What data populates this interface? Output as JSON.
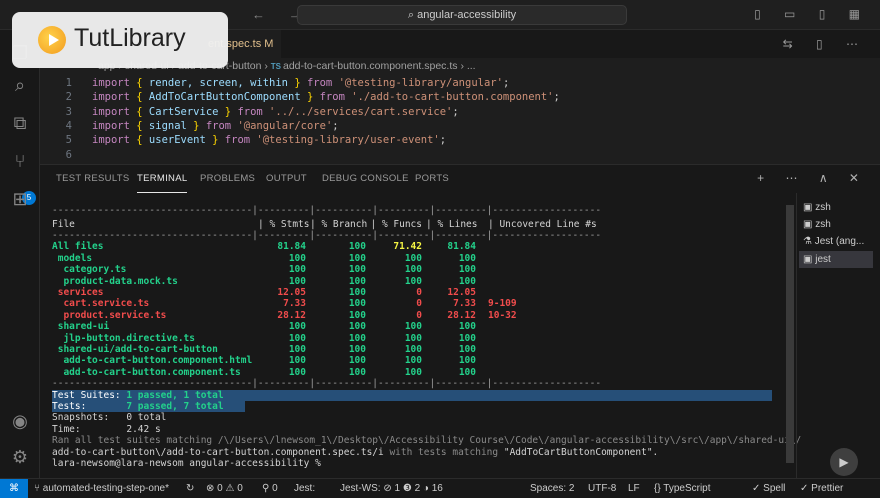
{
  "titlebar": {
    "search": "angular-accessibility",
    "nav": "← →"
  },
  "tab": {
    "label": "ent.spec.ts M"
  },
  "breadcrumb": {
    "text": "app › shared-ui › add-to-cart-button",
    "file": "add-to-cart-button.component.spec.ts",
    "ts": "TS",
    "more": "› ..."
  },
  "code": [
    {
      "n": "1",
      "parts": [
        [
          "kw",
          "import "
        ],
        [
          "br",
          "{ "
        ],
        [
          "id",
          "render, screen, within"
        ],
        [
          "br",
          " } "
        ],
        [
          "kw",
          "from "
        ],
        [
          "str",
          "'@testing-library/angular'"
        ],
        [
          "plain",
          ";"
        ]
      ]
    },
    {
      "n": "2",
      "parts": [
        [
          "kw",
          "import "
        ],
        [
          "br",
          "{ "
        ],
        [
          "id",
          "AddToCartButtonComponent"
        ],
        [
          "br",
          " } "
        ],
        [
          "kw",
          "from "
        ],
        [
          "str",
          "'./add-to-cart-button.component'"
        ],
        [
          "plain",
          ";"
        ]
      ]
    },
    {
      "n": "3",
      "parts": [
        [
          "kw",
          "import "
        ],
        [
          "br",
          "{ "
        ],
        [
          "id",
          "CartService"
        ],
        [
          "br",
          " } "
        ],
        [
          "kw",
          "from "
        ],
        [
          "str",
          "'../../services/cart.service'"
        ],
        [
          "plain",
          ";"
        ]
      ]
    },
    {
      "n": "4",
      "parts": [
        [
          "kw",
          "import "
        ],
        [
          "br",
          "{ "
        ],
        [
          "id",
          "signal"
        ],
        [
          "br",
          " } "
        ],
        [
          "kw",
          "from "
        ],
        [
          "str",
          "'@angular/core'"
        ],
        [
          "plain",
          ";"
        ]
      ]
    },
    {
      "n": "5",
      "parts": [
        [
          "kw",
          "import "
        ],
        [
          "br",
          "{ "
        ],
        [
          "id",
          "userEvent"
        ],
        [
          "br",
          " } "
        ],
        [
          "kw",
          "from "
        ],
        [
          "str",
          "'@testing-library/user-event'"
        ],
        [
          "plain",
          ";"
        ]
      ]
    },
    {
      "n": "6",
      "parts": []
    }
  ],
  "panel_tabs": [
    "TEST RESULTS",
    "TERMINAL",
    "PROBLEMS",
    "OUTPUT",
    "DEBUG CONSOLE",
    "PORTS"
  ],
  "coverage": {
    "header": [
      "File",
      "% Stmts",
      "% Branch",
      "% Funcs",
      "% Lines",
      "Uncovered Line #s"
    ],
    "rows": [
      {
        "file": "All files",
        "c": [
          "81.84",
          "100",
          "71.42",
          "81.84",
          ""
        ],
        "color": [
          "g",
          "g",
          "y",
          "g",
          ""
        ],
        "fc": "g"
      },
      {
        "file": " models",
        "c": [
          "100",
          "100",
          "100",
          "100",
          ""
        ],
        "color": [
          "g",
          "g",
          "g",
          "g",
          ""
        ],
        "fc": "g"
      },
      {
        "file": "  category.ts",
        "c": [
          "100",
          "100",
          "100",
          "100",
          ""
        ],
        "color": [
          "g",
          "g",
          "g",
          "g",
          ""
        ],
        "fc": "g"
      },
      {
        "file": "  product-data.mock.ts",
        "c": [
          "100",
          "100",
          "100",
          "100",
          ""
        ],
        "color": [
          "g",
          "g",
          "g",
          "g",
          ""
        ],
        "fc": "g"
      },
      {
        "file": " services",
        "c": [
          "12.05",
          "100",
          "0",
          "12.05",
          ""
        ],
        "color": [
          "r",
          "g",
          "r",
          "r",
          ""
        ],
        "fc": "r"
      },
      {
        "file": "  cart.service.ts",
        "c": [
          "7.33",
          "100",
          "0",
          "7.33",
          "9-109"
        ],
        "color": [
          "r",
          "g",
          "r",
          "r",
          "r"
        ],
        "fc": "r"
      },
      {
        "file": "  product.service.ts",
        "c": [
          "28.12",
          "100",
          "0",
          "28.12",
          "10-32"
        ],
        "color": [
          "r",
          "g",
          "r",
          "r",
          "r"
        ],
        "fc": "r"
      },
      {
        "file": " shared-ui",
        "c": [
          "100",
          "100",
          "100",
          "100",
          ""
        ],
        "color": [
          "g",
          "g",
          "g",
          "g",
          ""
        ],
        "fc": "g"
      },
      {
        "file": "  jlp-button.directive.ts",
        "c": [
          "100",
          "100",
          "100",
          "100",
          ""
        ],
        "color": [
          "g",
          "g",
          "g",
          "g",
          ""
        ],
        "fc": "g"
      },
      {
        "file": " shared-ui/add-to-cart-button",
        "c": [
          "100",
          "100",
          "100",
          "100",
          ""
        ],
        "color": [
          "g",
          "g",
          "g",
          "g",
          ""
        ],
        "fc": "g"
      },
      {
        "file": "  add-to-cart-button.component.html",
        "c": [
          "100",
          "100",
          "100",
          "100",
          ""
        ],
        "color": [
          "g",
          "g",
          "g",
          "g",
          ""
        ],
        "fc": "g"
      },
      {
        "file": "  add-to-cart-button.component.ts",
        "c": [
          "100",
          "100",
          "100",
          "100",
          ""
        ],
        "color": [
          "g",
          "g",
          "g",
          "g",
          ""
        ],
        "fc": "g"
      }
    ]
  },
  "summary": {
    "suites_label": "Test Suites: ",
    "suites_val": "1 passed, 1 total",
    "tests_label": "Tests:       ",
    "tests_val": "7 passed, 7 total",
    "snap": "Snapshots:   0 total",
    "time": "Time:        2.42 s",
    "ran1": "Ran all test suites matching /\\/Users\\/lnewsom_1\\/Desktop\\/Accessibility Course\\/Code\\/angular-accessibility\\/src\\/app\\/shared-ui\\/",
    "ran2a": "add-to-cart-button\\/add-to-cart-button.component.spec.ts/i",
    "ran2b": " with tests matching ",
    "ran2c": "\"AddToCartButtonComponent\".",
    "prompt": "lara-newsom@lara-newsom angular-accessibility % "
  },
  "terminals": [
    "zsh",
    "zsh",
    "Jest (ang...",
    "jest"
  ],
  "status": {
    "branch": "automated-testing-step-one*",
    "sync": "↻",
    "problems": "⊗ 0 ⚠ 0",
    "ports": "⚲ 0",
    "jest": "Jest: ",
    "jestws": "Jest-WS: ⊘ 1 ❸ 2 ◑ 16",
    "spaces": "Spaces: 2",
    "enc": "UTF-8",
    "eol": "LF",
    "lang": "{} TypeScript",
    "spell": "✓ Spell",
    "prettier": "✓ Prettier"
  },
  "logo": {
    "text": "TutLibrary"
  }
}
